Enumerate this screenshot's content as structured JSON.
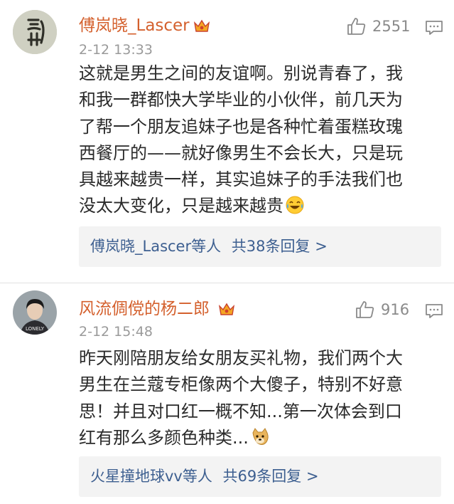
{
  "comments": [
    {
      "username": "傅岚晓_Lascer",
      "time": "2-12 13:33",
      "likes": "2551",
      "lines": [
        "这就是男生之间的友谊啊。别说青春了，我",
        "和我一群都快大学毕业的小伙伴，前几天为",
        "了帮一个朋友追妹子也是各种忙着蛋糕玫瑰",
        "西餐厅的——就好像男生不会长大，只是玩",
        "具越来越贵一样，其实追妹子的手法我们也",
        "没太大变化，只是越来越贵"
      ],
      "emoji": "laugh-cry-emoji",
      "replies_prefix": "傅岚晓_Lascer等人",
      "replies_count": "共38条回复 >"
    },
    {
      "username": "风流倜傥的杨二郎",
      "time": "2-12 15:48",
      "likes": "916",
      "lines": [
        "昨天刚陪朋友给女朋友买礼物，我们两个大",
        "男生在兰蔻专柜像两个大傻子，特别不好意",
        "思！并且对口红一概不知...第一次体会到口",
        "红有那么多颜色种类..."
      ],
      "emoji": "doge-emoji",
      "replies_prefix": "火星撞地球vv等人",
      "replies_count": "共69条回复 >"
    }
  ],
  "colors": {
    "username": "#d4602d",
    "link": "#3d5f90",
    "muted": "#9a9a9a"
  }
}
